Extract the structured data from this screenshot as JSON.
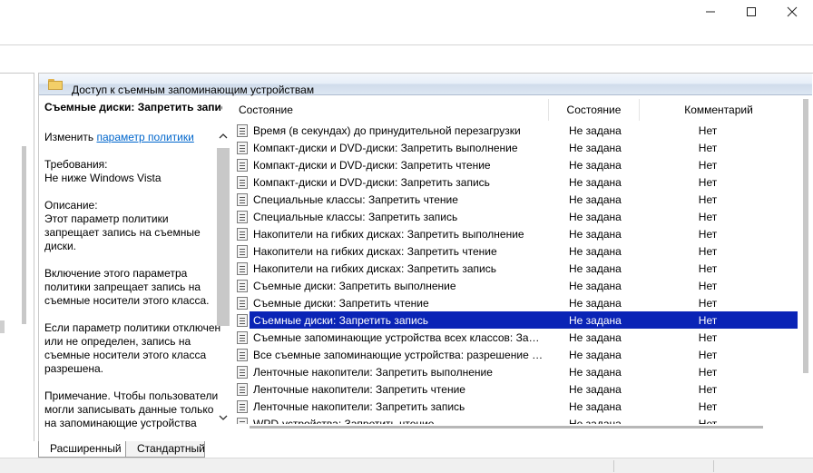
{
  "window": {
    "controls": {
      "minimize": "minimize-icon",
      "maximize": "maximize-icon",
      "close": "close-icon"
    }
  },
  "folder": {
    "title": "Доступ к съемным запоминающим устройствам"
  },
  "description": {
    "title": "Съемные диски: Запретить запись",
    "edit_prefix": "Изменить",
    "edit_link": "параметр политики",
    "requirements_label": "Требования:",
    "requirements_value": "Не ниже Windows Vista",
    "desc_label": "Описание:",
    "desc_text": "Этот параметр политики запрещает запись на съемные диски.",
    "enable_text": "Включение этого параметра политики запрещает запись на съемные носители этого класса.",
    "disable_text": "Если параметр политики отключен или не определен, запись на съемные носители этого класса разрешена.",
    "note_text": "Примечание. Чтобы пользователи могли записывать данные только на запоминающие устройства"
  },
  "table": {
    "columns": [
      "Состояние",
      "Состояние",
      "Комментарий"
    ],
    "rows": [
      {
        "name": "Время (в секундах) до принудительной перезагрузки",
        "state": "Не задана",
        "comment": "Нет"
      },
      {
        "name": "Компакт-диски и DVD-диски: Запретить выполнение",
        "state": "Не задана",
        "comment": "Нет"
      },
      {
        "name": "Компакт-диски и DVD-диски: Запретить чтение",
        "state": "Не задана",
        "comment": "Нет"
      },
      {
        "name": "Компакт-диски и DVD-диски: Запретить запись",
        "state": "Не задана",
        "comment": "Нет"
      },
      {
        "name": "Специальные классы: Запретить чтение",
        "state": "Не задана",
        "comment": "Нет"
      },
      {
        "name": "Специальные классы: Запретить запись",
        "state": "Не задана",
        "comment": "Нет"
      },
      {
        "name": "Накопители на гибких дисках: Запретить выполнение",
        "state": "Не задана",
        "comment": "Нет"
      },
      {
        "name": "Накопители на гибких дисках: Запретить чтение",
        "state": "Не задана",
        "comment": "Нет"
      },
      {
        "name": "Накопители на гибких дисках: Запретить запись",
        "state": "Не задана",
        "comment": "Нет"
      },
      {
        "name": "Съемные диски: Запретить выполнение",
        "state": "Не задана",
        "comment": "Нет"
      },
      {
        "name": "Съемные диски: Запретить чтение",
        "state": "Не задана",
        "comment": "Нет"
      },
      {
        "name": "Съемные диски: Запретить запись",
        "state": "Не задана",
        "comment": "Нет",
        "selected": true
      },
      {
        "name": "Съемные запоминающие устройства всех классов: Запр...",
        "state": "Не задана",
        "comment": "Нет"
      },
      {
        "name": "Все съемные запоминающие устройства: разрешение п...",
        "state": "Не задана",
        "comment": "Нет"
      },
      {
        "name": "Ленточные накопители: Запретить выполнение",
        "state": "Не задана",
        "comment": "Нет"
      },
      {
        "name": "Ленточные накопители: Запретить чтение",
        "state": "Не задана",
        "comment": "Нет"
      },
      {
        "name": "Ленточные накопители: Запретить запись",
        "state": "Не задана",
        "comment": "Нет"
      },
      {
        "name": "WPD-устройства: Запретить чтение",
        "state": "Не задана",
        "comment": "Нет"
      }
    ]
  },
  "tabs": {
    "extended": "Расширенный",
    "standard": "Стандартный"
  }
}
